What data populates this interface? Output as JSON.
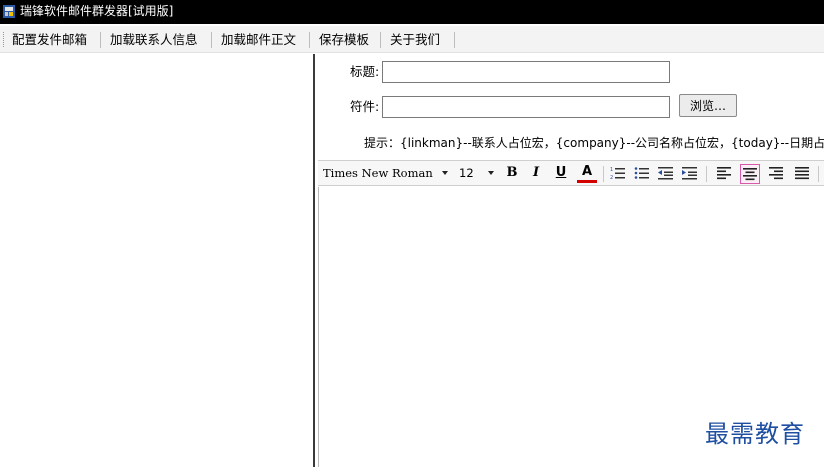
{
  "window": {
    "title": "瑞锋软件邮件群发器[试用版]",
    "icon": "app-icon"
  },
  "menu": {
    "items": [
      "配置发件邮箱",
      "加载联系人信息",
      "加载邮件正文",
      "保存模板",
      "关于我们"
    ]
  },
  "form": {
    "subject_label": "标题:",
    "subject_value": "",
    "attachment_label": "符件:",
    "attachment_value": "",
    "browse_label": "浏览…"
  },
  "hint": {
    "text": "提示：{linkman}--联系人占位宏，{company}--公司名称占位宏，{today}--日期占"
  },
  "editor_toolbar": {
    "font_name": "Times New Roman",
    "font_size": "12",
    "bold": "B",
    "italic": "I",
    "underline": "U",
    "font_color": "A",
    "font_color_swatch": "#d40000",
    "active_button": "align-center",
    "buttons": [
      "bold",
      "italic",
      "underline",
      "font-color",
      "ordered-list",
      "unordered-list",
      "outdent",
      "indent",
      "align-left",
      "align-center",
      "align-right",
      "align-justify"
    ]
  },
  "editor": {
    "content": ""
  },
  "watermark": {
    "text": "最需教育",
    "color": "#1f4fa0"
  }
}
